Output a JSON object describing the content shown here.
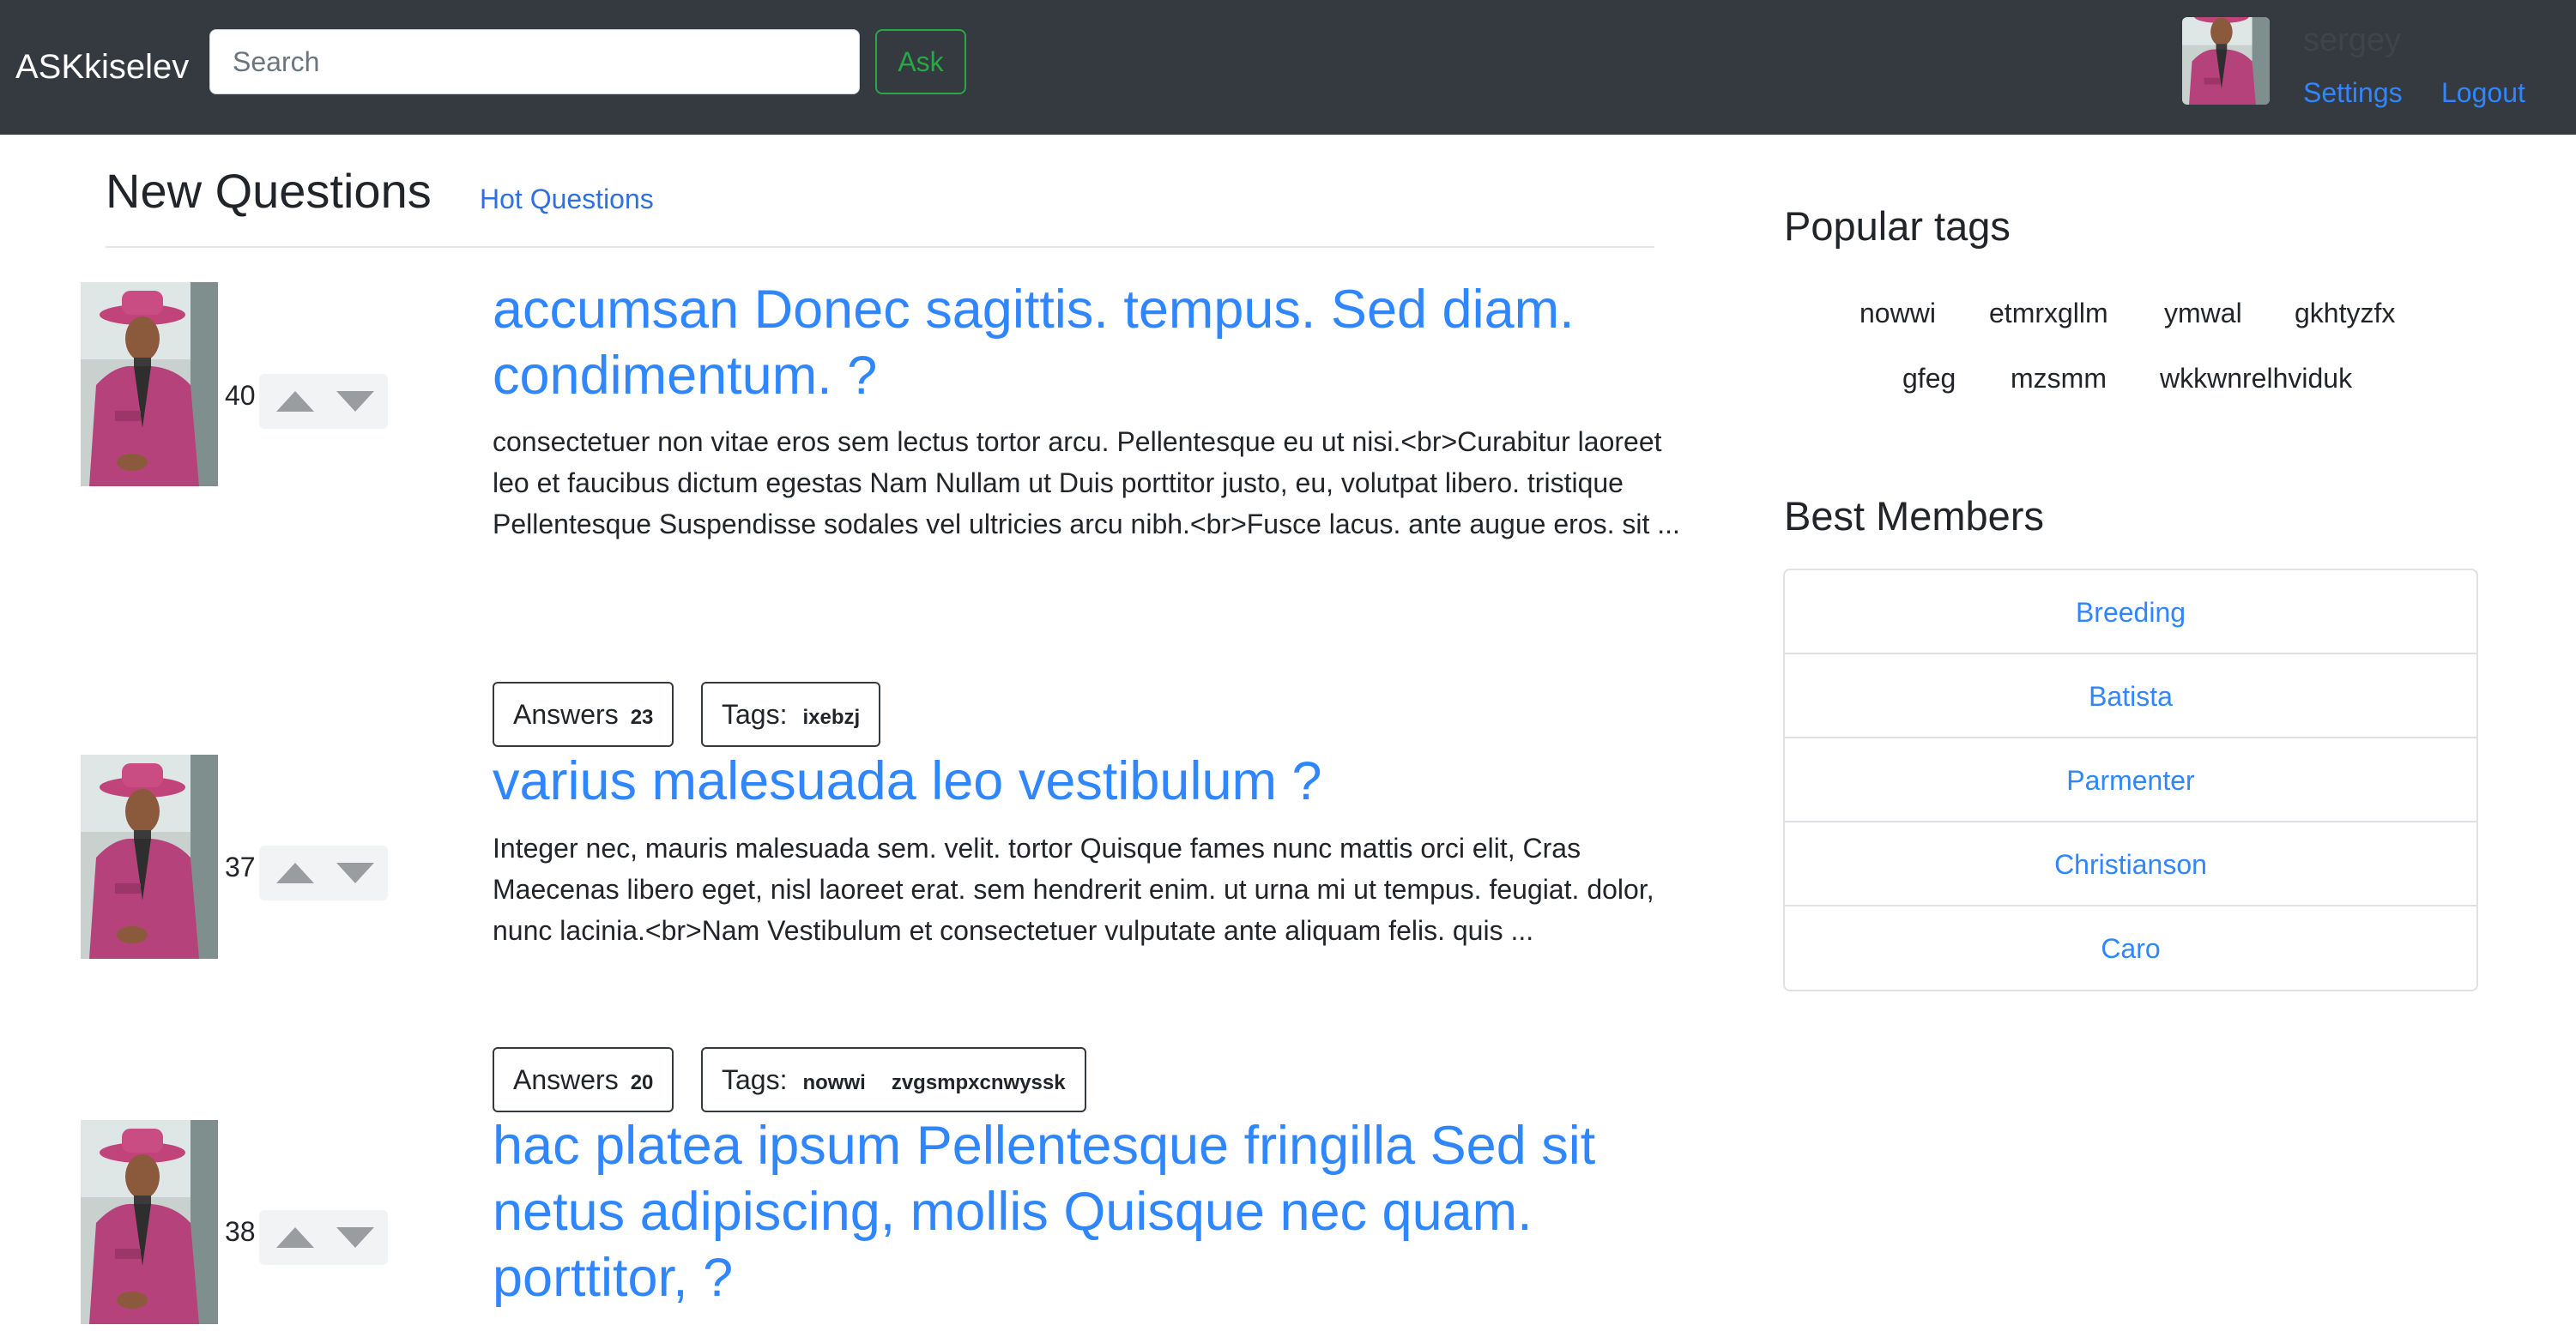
{
  "header": {
    "brand": "ASKkiselev",
    "search_placeholder": "Search",
    "ask_label": "Ask",
    "username": "sergey",
    "settings_label": "Settings",
    "logout_label": "Logout"
  },
  "main": {
    "new_questions_label": "New Questions",
    "hot_questions_label": "Hot Questions",
    "questions": [
      {
        "rating": "40",
        "title": "accumsan Donec sagittis. tempus. Sed diam. condimentum. ?",
        "text": "consectetuer non vitae eros sem lectus tortor arcu. Pellentesque eu ut nisi.<br>Curabitur laoreet leo et faucibus dictum egestas Nam Nullam ut Duis porttitor justo, eu, volutpat libero. tristique Pellentesque Suspendisse sodales vel ultricies arcu nibh.<br>Fusce lacus. ante augue eros. sit ...",
        "answers_label": "Answers",
        "answers_count": "23",
        "tags_label": "Tags:",
        "tags": [
          "ixebzj"
        ]
      },
      {
        "rating": "37",
        "title": "varius malesuada leo vestibulum ?",
        "text": "Integer nec, mauris malesuada sem. velit. tortor Quisque fames nunc mattis orci elit, Cras Maecenas libero eget, nisl laoreet erat. sem hendrerit enim. ut urna mi ut tempus. feugiat. dolor, nunc lacinia.<br>Nam Vestibulum et consectetuer vulputate ante aliquam felis. quis ...",
        "answers_label": "Answers",
        "answers_count": "20",
        "tags_label": "Tags:",
        "tags": [
          "nowwi",
          "zvgsmpxcnwyssk"
        ]
      },
      {
        "rating": "38",
        "title": "hac platea ipsum Pellentesque fringilla Sed sit netus adipiscing, mollis Quisque nec quam. porttitor, ?"
      }
    ]
  },
  "sidebar": {
    "popular_tags_title": "Popular tags",
    "tags": [
      "nowwi",
      "etmrxgllm",
      "ymwal",
      "gkhtyzfx",
      "gfeg",
      "mzsmm",
      "wkkwnrelhviduk"
    ],
    "best_members_title": "Best Members",
    "members": [
      "Breeding",
      "Batista",
      "Parmenter",
      "Christianson",
      "Caro"
    ]
  },
  "colors": {
    "navbar": "#343a40",
    "link": "#2f86ff",
    "ask_button": "#28a745"
  }
}
